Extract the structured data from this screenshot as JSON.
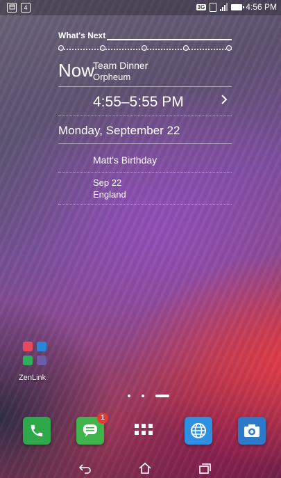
{
  "status_bar": {
    "left_icons": [
      "calendar-icon",
      "notification-count-icon"
    ],
    "notification_count": "4",
    "network_type": "3G",
    "time": "4:56 PM",
    "icons": [
      "sim-icon",
      "signal-icon",
      "battery-icon"
    ]
  },
  "whats_next_widget": {
    "title": "What's Next",
    "now_label": "Now",
    "current_event": {
      "title": "Team Dinner",
      "location": "Orpheum",
      "time_range": "4:55–5:55 PM"
    },
    "date_heading": "Monday, September 22",
    "upcoming": [
      {
        "title": "Matt's Birthday"
      },
      {
        "date": "Sep 22",
        "location": "England"
      }
    ]
  },
  "folder": {
    "label": "ZenLink",
    "app_colors": [
      "#e8495f",
      "#2a86d8",
      "#2dae5b",
      "#6c5ca8"
    ]
  },
  "pager": {
    "count": 3,
    "active_index": 2
  },
  "dock": [
    {
      "name": "phone-app",
      "icon": "phone-icon",
      "color": "#2ea84a"
    },
    {
      "name": "messaging-app",
      "icon": "message-icon",
      "color": "#3fb44b",
      "badge": "1"
    },
    {
      "name": "all-apps",
      "icon": "apps-grid-icon"
    },
    {
      "name": "browser-app",
      "icon": "globe-icon",
      "color": "#2f8fe0"
    },
    {
      "name": "camera-app",
      "icon": "camera-icon",
      "color": "#2f79c9"
    }
  ],
  "nav_bar": [
    "back-icon",
    "home-icon",
    "recents-icon"
  ]
}
